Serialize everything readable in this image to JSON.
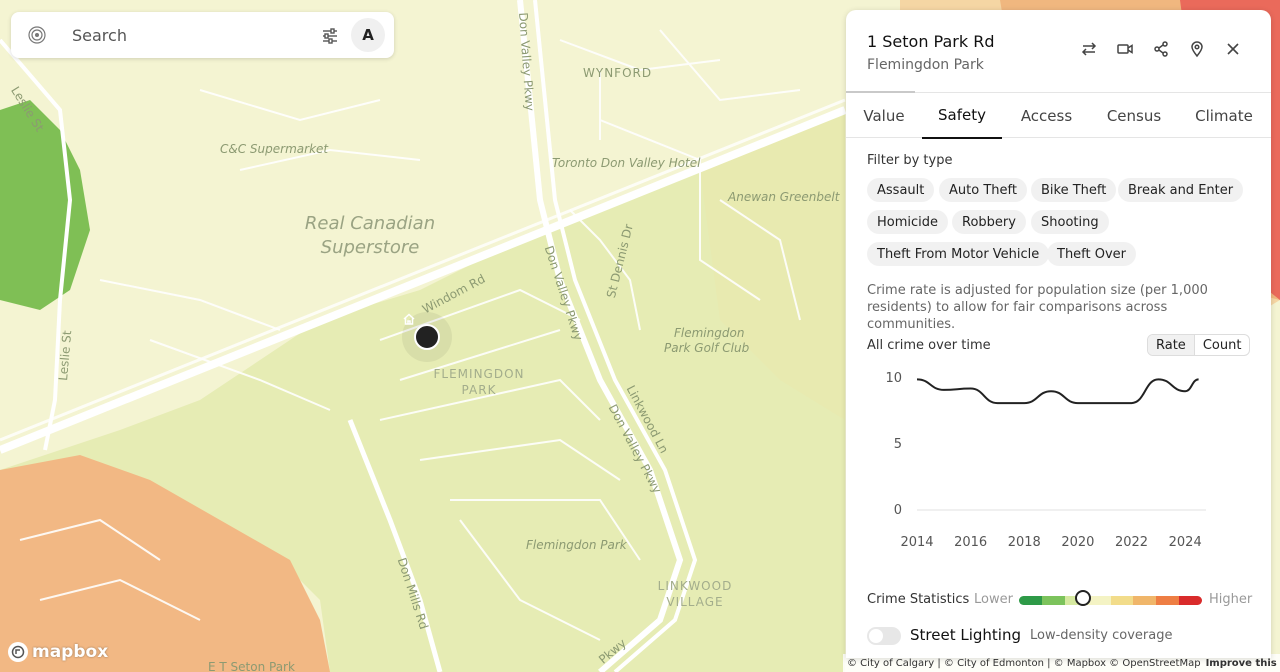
{
  "search": {
    "placeholder": "Search",
    "avatar_initial": "A"
  },
  "map": {
    "labels": {
      "wynford": "WYNFORD",
      "leslie_st_top": "Leslie St",
      "leslie_st_bottom": "Leslie St",
      "don_valley_pkwy_top": "Don Valley Pkwy",
      "don_valley_pkwy_mid": "Don Valley Pkwy",
      "don_valley_pkwy_lower": "Don Valley Pkwy",
      "don_valley_pkwy_bottom": "Pkwy",
      "cc_supermarket": "C&C Supermarket",
      "toronto_hotel": "Toronto Don Valley Hotel",
      "anewan": "Anewan Greenbelt",
      "real_canadian_1": "Real Canadian",
      "real_canadian_2": "Superstore",
      "st_dennis": "St Dennis Dr",
      "windom": "Windom Rd",
      "flemingdon_1": "FLEMINGDON",
      "flemingdon_2": "PARK",
      "golf_1": "Flemingdon",
      "golf_2": "Park Golf Club",
      "linkwood_ln": "Linkwood Ln",
      "flemingdon_park": "Flemingdon Park",
      "linkwood_village_1": "LINKWOOD",
      "linkwood_village_2": "VILLAGE",
      "don_mills": "Don Mills Rd",
      "seton_park": "E T Seton Park"
    },
    "colors": {
      "yellow": "#f4f4d2",
      "green": "#e6ecb4",
      "orange": "#f2b884",
      "red": "#ef5b55",
      "darkgreen": "#7fbf55"
    }
  },
  "mapbox": {
    "logo_text": "mapbox"
  },
  "attribution": {
    "text": "© City of Calgary | © City of Edmonton | © Mapbox © OpenStreetMap",
    "improve": "Improve this map"
  },
  "panel": {
    "title": "1 Seton Park Rd",
    "subtitle": "Flemingdon Park",
    "tabs": [
      "Value",
      "Safety",
      "Access",
      "Census",
      "Climate"
    ],
    "active_tab": "Safety",
    "filter_label": "Filter by type",
    "chips": [
      "Assault",
      "Auto Theft",
      "Bike Theft",
      "Break and Enter",
      "Homicide",
      "Robbery",
      "Shooting",
      "Theft From Motor Vehicle",
      "Theft Over"
    ],
    "note": "Crime rate is adjusted for population size (per 1,000 residents) to allow for fair comparisons across communities.",
    "chart_title": "All crime over time",
    "toggle": {
      "rate": "Rate",
      "count": "Count",
      "selected": "Rate"
    },
    "legend": {
      "label": "Crime Statistics",
      "lower": "Lower",
      "higher": "Higher",
      "position_fraction": 0.35,
      "colors": [
        "#2e9a48",
        "#7cc35c",
        "#d6e9a0",
        "#f4f3c4",
        "#f2dc8a",
        "#f0b66a",
        "#ee7e44",
        "#d92b2b"
      ]
    },
    "lighting": {
      "label": "Street Lighting",
      "desc": "Low-density coverage",
      "on": false
    }
  },
  "chart_data": {
    "type": "line",
    "title": "All crime over time",
    "x": [
      2014,
      2015,
      2016,
      2017,
      2018,
      2019,
      2020,
      2021,
      2022,
      2023,
      2024,
      2024.5
    ],
    "y": [
      9.9,
      9.1,
      9.2,
      8.1,
      8.1,
      9.0,
      8.1,
      8.1,
      8.1,
      9.9,
      9.0,
      9.9
    ],
    "xticks": [
      2014,
      2016,
      2018,
      2020,
      2022,
      2024
    ],
    "yticks": [
      0,
      5,
      10
    ],
    "ylim": [
      0,
      10
    ],
    "xlim": [
      2014,
      2025
    ]
  }
}
